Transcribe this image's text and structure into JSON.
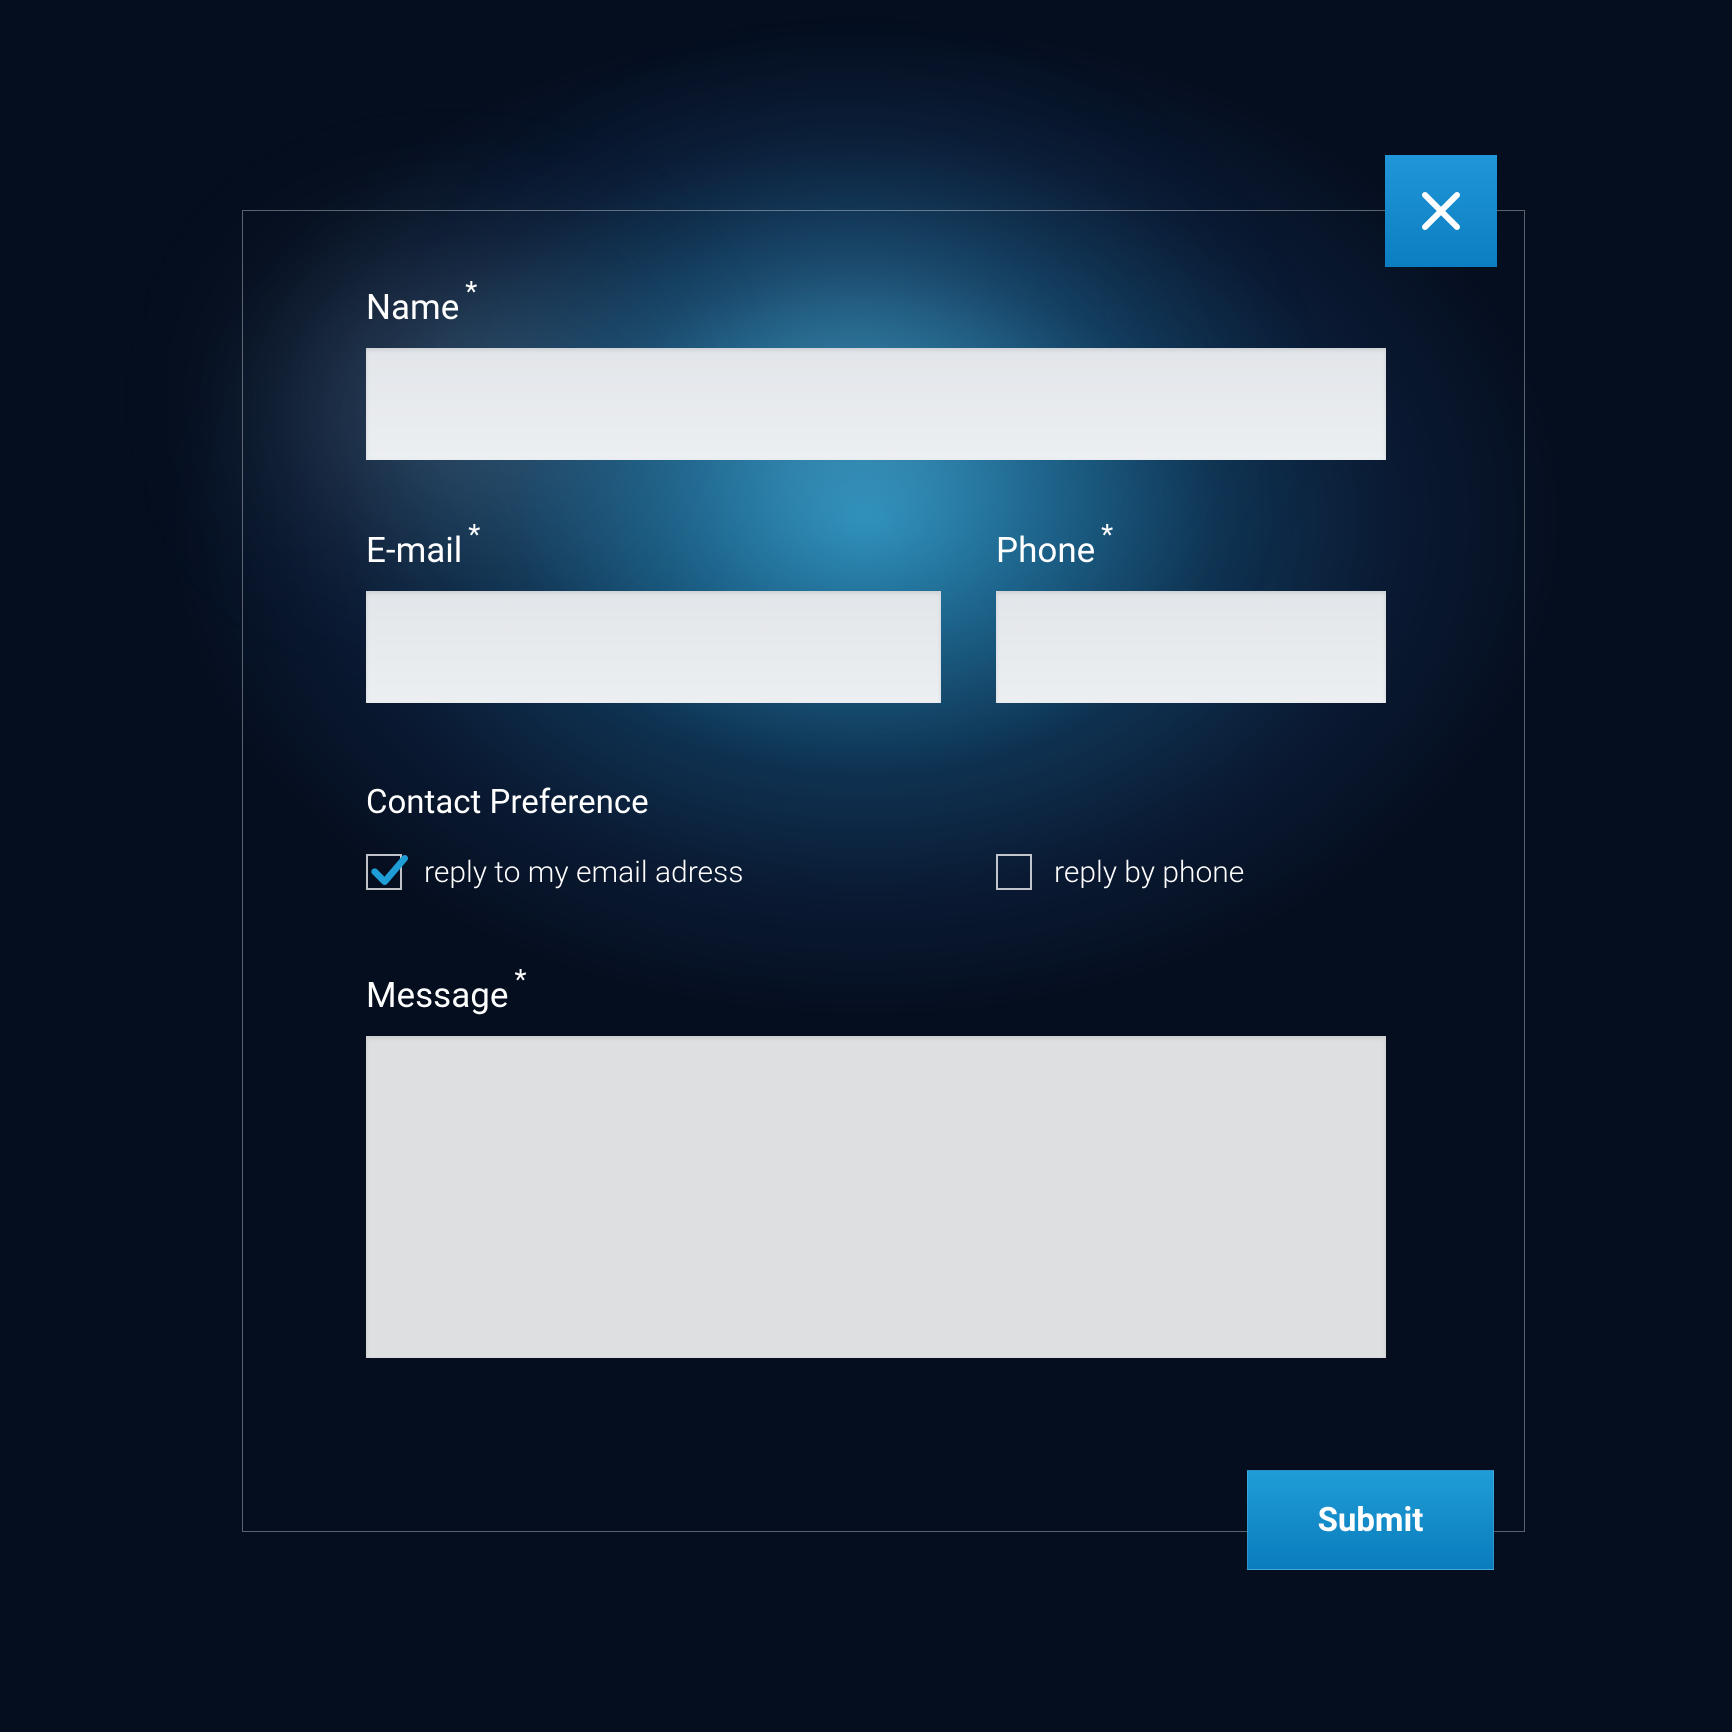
{
  "form": {
    "name": {
      "label": "Name",
      "required": "*",
      "value": ""
    },
    "email": {
      "label": "E-mail",
      "required": "*",
      "value": ""
    },
    "phone": {
      "label": "Phone",
      "required": "*",
      "value": ""
    },
    "contact_pref": {
      "title": "Contact Preference",
      "opt_email": {
        "label": "reply to my email adress",
        "checked": true
      },
      "opt_phone": {
        "label": "reply by phone",
        "checked": false
      }
    },
    "message": {
      "label": "Message",
      "required": "*",
      "value": ""
    },
    "submit_label": "Submit"
  }
}
